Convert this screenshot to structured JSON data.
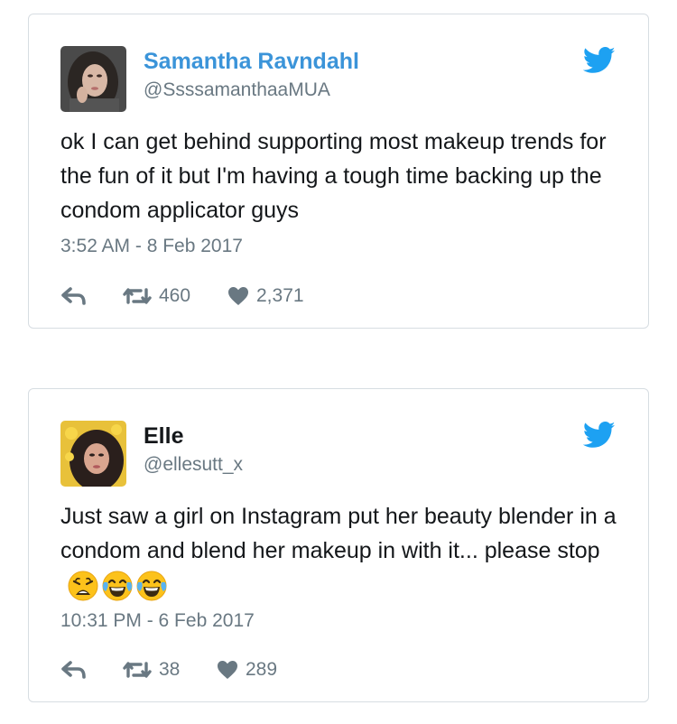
{
  "tweets": [
    {
      "name": "Samantha Ravndahl",
      "handle": "@SsssamanthaaMUA",
      "text": "ok I can get behind supporting most makeup trends for the fun of it but I'm having a tough time backing up the condom applicator guys",
      "emojis": [],
      "timestamp": "3:52 AM - 8 Feb 2017",
      "retweets": "460",
      "likes": "2,371"
    },
    {
      "name": "Elle",
      "handle": "@ellesutt_x",
      "text": "Just saw a girl on Instagram put her beauty blender in a condom and blend her makeup in with it... please stop",
      "emojis": [
        "weary-face",
        "face-with-tears-of-joy",
        "face-with-tears-of-joy"
      ],
      "timestamp": "10:31 PM - 6 Feb 2017",
      "retweets": "38",
      "likes": "289"
    }
  ],
  "colors": {
    "twitter_blue": "#1da1f2",
    "link_blue": "#3b94d9",
    "muted_gray": "#697882",
    "border": "#d7dde2"
  },
  "icons": {
    "brand": "twitter-bird-icon",
    "reply": "reply-icon",
    "retweet": "retweet-icon",
    "like": "heart-icon"
  }
}
